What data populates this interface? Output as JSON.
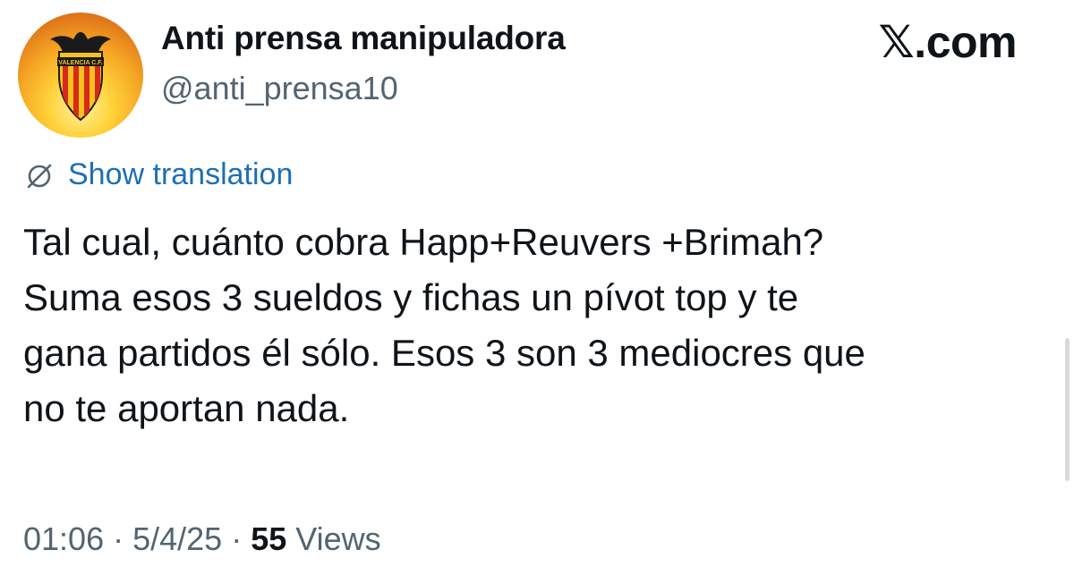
{
  "header": {
    "display_name": "Anti prensa manipuladora",
    "handle": "@anti_prensa10",
    "brand": "𝕏.com",
    "avatar_icon": "valencia-cf-crest-icon",
    "avatar_text": "VALENCIA C.F."
  },
  "translation": {
    "icon": "translate-icon",
    "label": "Show translation"
  },
  "tweet": {
    "lines": [
      "Tal cual, cuánto cobra Happ+Reuvers +Brimah?",
      "Suma esos 3 sueldos y fichas un pívot top y te",
      "gana partidos él sólo. Esos 3 son 3 mediocres que",
      "no te aportan nada."
    ]
  },
  "meta": {
    "time": "01:06",
    "separator": " · ",
    "date": "5/4/25",
    "views_count": "55",
    "views_label": " Views"
  },
  "colors": {
    "link": "#1d6fb8",
    "secondary": "#536471",
    "text": "#0f1419"
  }
}
